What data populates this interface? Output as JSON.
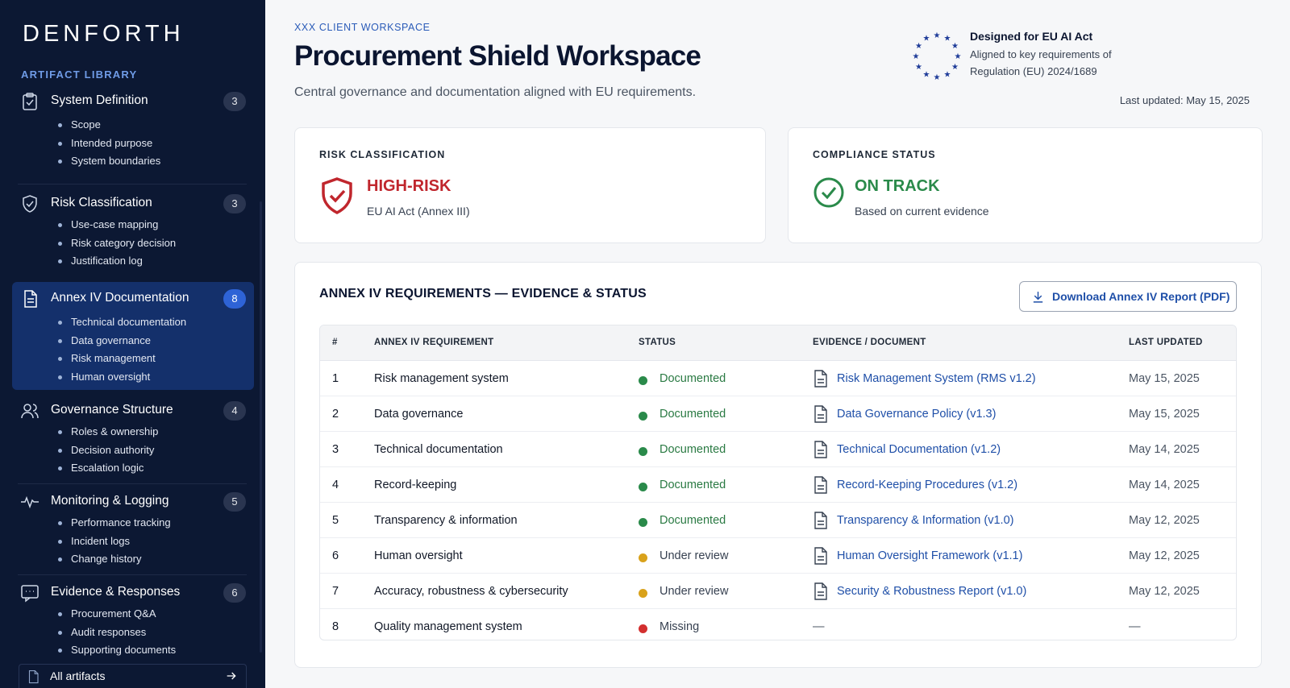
{
  "sidebar": {
    "logo": "DENFORTH",
    "library_label": "ARTIFACT LIBRARY",
    "sections": [
      {
        "title": "System Definition",
        "count": "3",
        "items": [
          "Scope",
          "Intended purpose",
          "System boundaries"
        ],
        "icon": "clipboard-icon"
      },
      {
        "title": "Risk Classification",
        "count": "3",
        "items": [
          "Use-case mapping",
          "Risk category decision",
          "Justification log"
        ],
        "icon": "shield-check-icon"
      },
      {
        "title": "Annex IV Documentation",
        "count": "8",
        "items": [
          "Technical documentation",
          "Data governance",
          "Risk management",
          "Human oversight"
        ],
        "icon": "document-icon",
        "active": true
      },
      {
        "title": "Governance Structure",
        "count": "4",
        "items": [
          "Roles & ownership",
          "Decision authority",
          "Escalation logic"
        ],
        "icon": "users-icon"
      },
      {
        "title": "Monitoring & Logging",
        "count": "5",
        "items": [
          "Performance tracking",
          "Incident logs",
          "Change history"
        ],
        "icon": "pulse-icon"
      },
      {
        "title": "Evidence & Responses",
        "count": "6",
        "items": [
          "Procurement Q&A",
          "Audit responses",
          "Supporting documents"
        ],
        "icon": "chat-icon"
      }
    ],
    "all_artifacts": "All artifacts"
  },
  "header": {
    "client_label": "XXX CLIENT WORKSPACE",
    "title": "Procurement Shield Workspace",
    "subtitle": "Central governance and documentation aligned with EU requirements.",
    "eu_heading": "Designed for EU AI Act",
    "eu_line1": "Aligned to key requirements of",
    "eu_line2": "Regulation (EU) 2024/1689",
    "last_updated": "Last updated: May 15, 2025"
  },
  "risk_card": {
    "label": "RISK CLASSIFICATION",
    "value": "HIGH-RISK",
    "sub": "EU AI Act (Annex III)",
    "color": "#c0262d"
  },
  "compliance_card": {
    "label": "COMPLIANCE STATUS",
    "value": "ON TRACK",
    "sub": "Based on current evidence",
    "color": "#2a8a4a"
  },
  "requirements": {
    "title": "ANNEX IV REQUIREMENTS — EVIDENCE & STATUS",
    "download_label": "Download Annex IV Report (PDF)",
    "columns": [
      "#",
      "ANNEX IV REQUIREMENT",
      "STATUS",
      "EVIDENCE / DOCUMENT",
      "LAST UPDATED"
    ],
    "status_colors": {
      "Documented": "#2a8a4a",
      "Under review": "#d9a21b",
      "Missing": "#d32f2f"
    },
    "rows": [
      {
        "num": "1",
        "req": "Risk management system",
        "status": "Documented",
        "doc": "Risk Management System (RMS v1.2)",
        "date": "May 15, 2025"
      },
      {
        "num": "2",
        "req": "Data governance",
        "status": "Documented",
        "doc": "Data Governance Policy (v1.3)",
        "date": "May 15, 2025"
      },
      {
        "num": "3",
        "req": "Technical documentation",
        "status": "Documented",
        "doc": "Technical Documentation (v1.2)",
        "date": "May 14, 2025"
      },
      {
        "num": "4",
        "req": "Record-keeping",
        "status": "Documented",
        "doc": "Record-Keeping Procedures (v1.2)",
        "date": "May 14, 2025"
      },
      {
        "num": "5",
        "req": "Transparency & information",
        "status": "Documented",
        "doc": "Transparency & Information (v1.0)",
        "date": "May 12, 2025"
      },
      {
        "num": "6",
        "req": "Human oversight",
        "status": "Under review",
        "doc": "Human Oversight Framework (v1.1)",
        "date": "May 12, 2025"
      },
      {
        "num": "7",
        "req": "Accuracy, robustness & cybersecurity",
        "status": "Under review",
        "doc": "Security & Robustness Report (v1.0)",
        "date": "May 12, 2025"
      },
      {
        "num": "8",
        "req": "Quality management system",
        "status": "Missing",
        "doc": "—",
        "date": "—"
      }
    ]
  }
}
